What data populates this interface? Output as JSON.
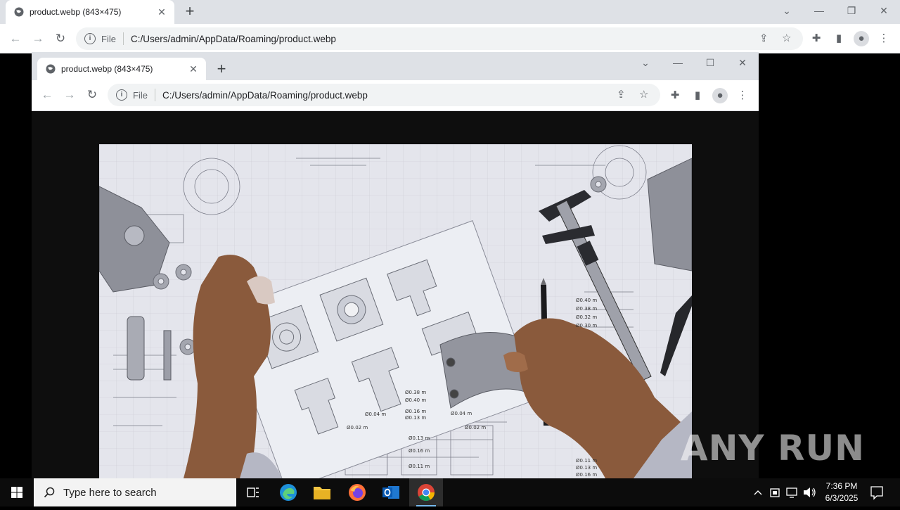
{
  "outer_browser": {
    "tab_title": "product.webp (843×475)",
    "scheme": "File",
    "url": "C:/Users/admin/AppData/Roaming/product.webp"
  },
  "inner_browser": {
    "tab_title": "product.webp (843×475)",
    "scheme": "File",
    "url": "C:/Users/admin/AppData/Roaming/product.webp"
  },
  "image": {
    "blueprint_labels": [
      "Ø0.40 m",
      "Ø0.38 m",
      "Ø0.32 m",
      "Ø0.30 m",
      "Ø0.38 m",
      "Ø0.40 m",
      "Ø0.16 m",
      "Ø0.13 m",
      "Ø0.04 m",
      "Ø0.02 m",
      "Ø0.13 m",
      "Ø0.16 m",
      "Ø0.11 m",
      "Ø0.11 m",
      "Ø0.13 m",
      "Ø0.16 m",
      "Ø0.02 m",
      "Ø0.04 m"
    ]
  },
  "taskbar": {
    "search_placeholder": "Type here to search",
    "time": "7:36 PM",
    "date": "6/3/2025"
  },
  "watermark": "ANY RUN",
  "colors": {
    "accent": "#76b9ed",
    "tabbar": "#dee1e6",
    "taskbar": "#0c0c0c"
  }
}
